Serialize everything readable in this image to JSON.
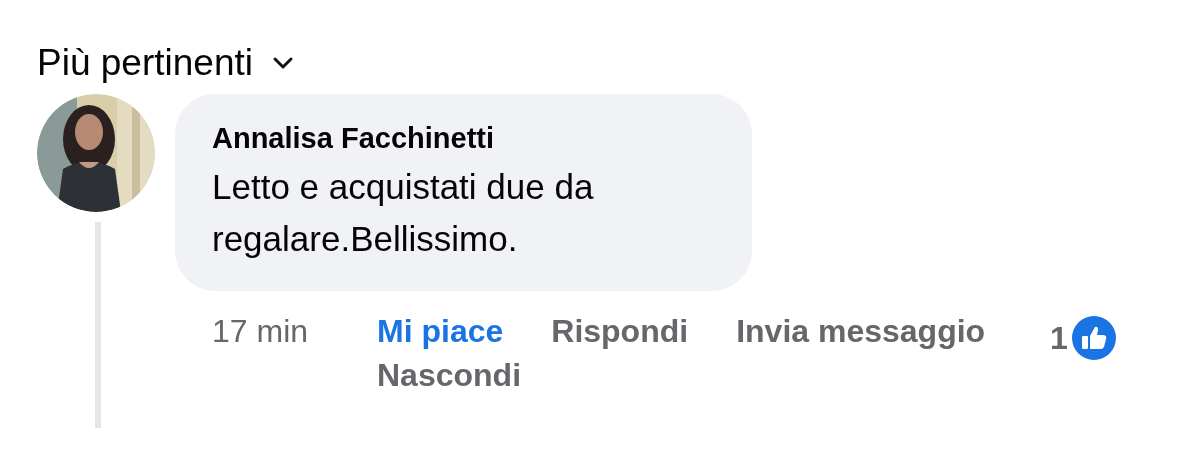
{
  "sort": {
    "label": "Più pertinenti"
  },
  "comment": {
    "author": "Annalisa Facchinetti",
    "text": "Letto e acquistati due da regalare.Bellissimo.",
    "time": "17 min",
    "actions": [
      {
        "label": "Mi piace",
        "selected": true
      },
      {
        "label": "Rispondi",
        "selected": false
      },
      {
        "label": "Invia messaggio",
        "selected": false
      },
      {
        "label": "Nascondi",
        "selected": false
      }
    ],
    "reactions": {
      "count": "1"
    }
  }
}
